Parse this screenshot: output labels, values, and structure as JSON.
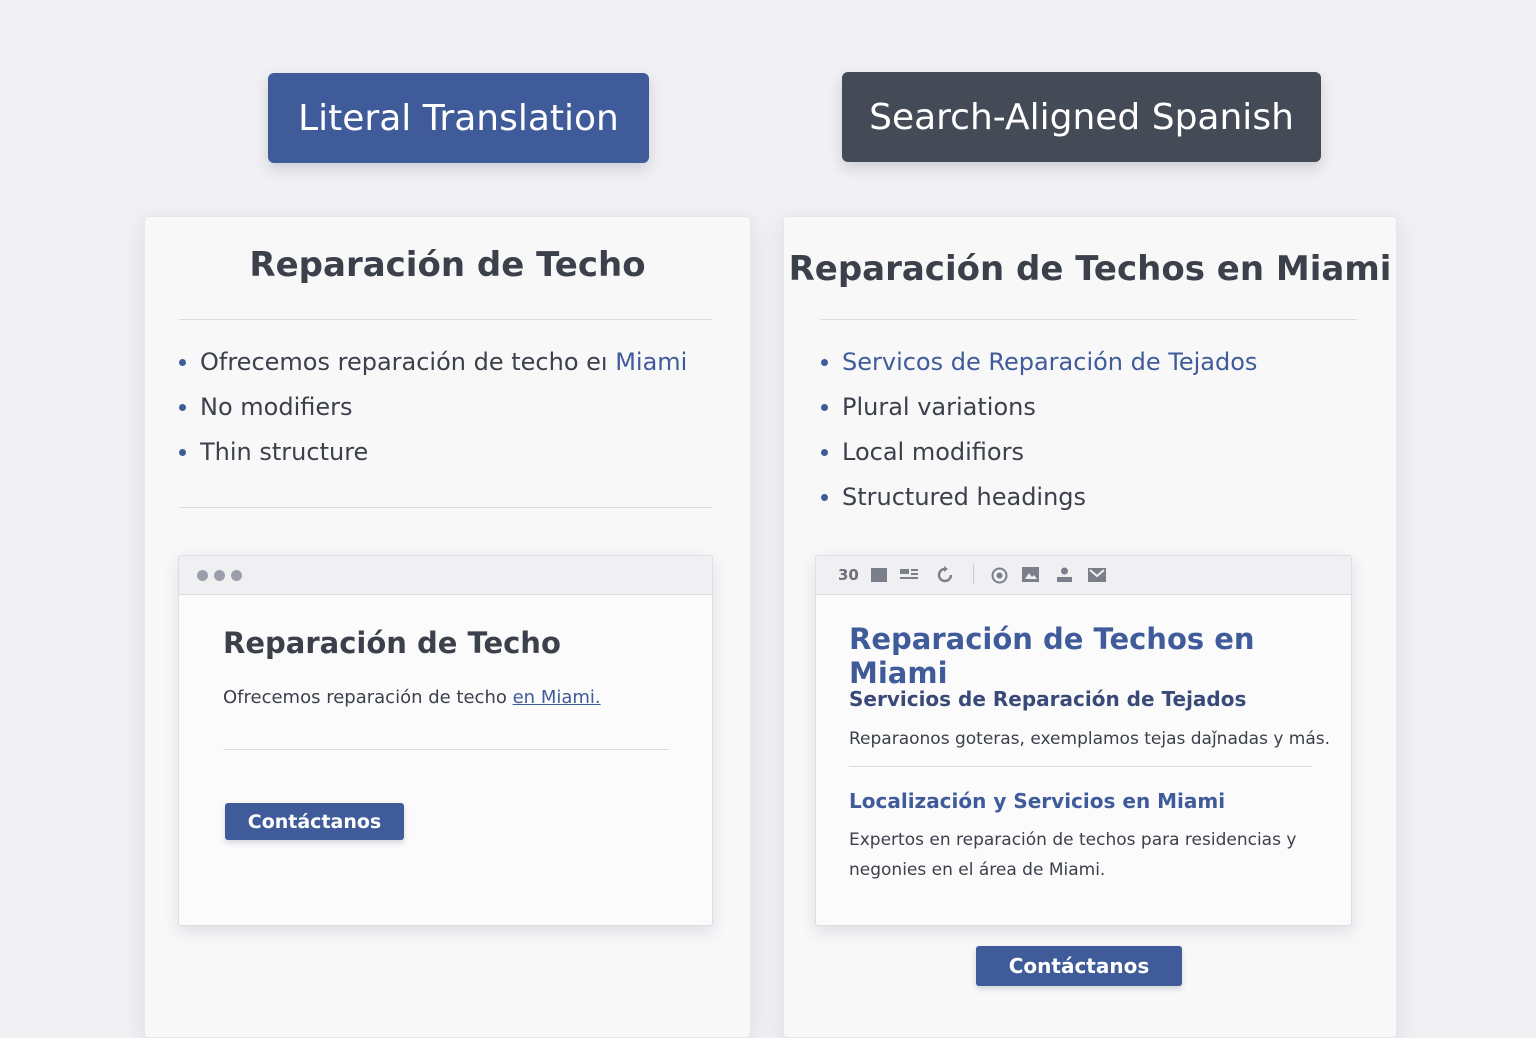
{
  "left_label": "Literal Translation",
  "right_label": "Search-Aligned Spanish",
  "left_panel": {
    "title": "Reparación de Techo",
    "bullets": [
      {
        "text": "Ofrecemos reparación de techo eı ",
        "accent": "Miami"
      },
      {
        "text": "No modifiers"
      },
      {
        "text": "Thin structure"
      }
    ],
    "mockup": {
      "title": "Reparación de Techo",
      "text": "Ofrecemos reparación de techo ",
      "link": "en Miami.",
      "button": "Contáctanos"
    }
  },
  "right_panel": {
    "title": "Reparación de Techos en Miami",
    "bullets": [
      {
        "accent": "Servicos de Reparación de Tejados"
      },
      {
        "text": "Plural variations"
      },
      {
        "text": "Local modifiors"
      },
      {
        "text": "Structured headings"
      }
    ],
    "mockup": {
      "toolbar_label": "30",
      "toolbar_icons": [
        "square-icon",
        "list-icon",
        "refresh-icon",
        "target-icon",
        "image-icon",
        "user-icon",
        "mail-icon"
      ],
      "title": "Reparación de Techos en Miami",
      "section1_heading": "Servicios de Reparación de Tejados",
      "section1_text": "Reparaonos goteras, exemplamos tejas daǰnadas y más.",
      "section2_heading": "Localización y Servicios en Miami",
      "section2_text_line1": "Expertos en reparación de techos para residencias y",
      "section2_text_line2": "negonies en el área de Miami."
    },
    "button": "Contáctanos"
  },
  "colors": {
    "accent_blue": "#3f5b9a",
    "dark_badge": "#454b56",
    "background": "#f1f1f4"
  }
}
